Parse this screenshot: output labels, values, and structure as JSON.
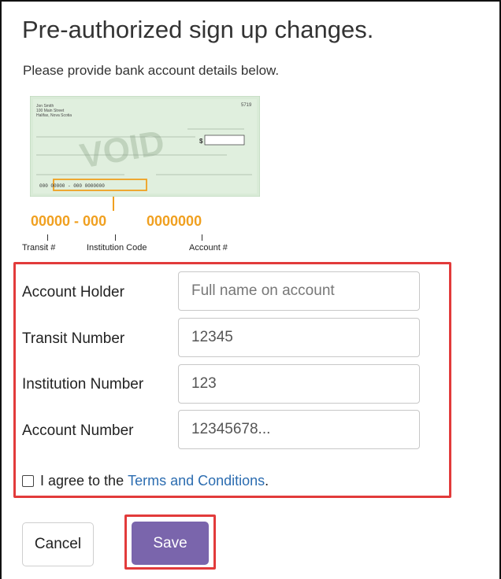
{
  "page": {
    "title": "Pre-authorized sign up changes.",
    "subtitle": "Please provide bank account details below."
  },
  "cheque": {
    "name_line1": "Jon Smith",
    "name_line2": "100 Main Street",
    "name_line3": "Halifax, Nova Scotia",
    "number": "5719",
    "void_text": "VOID",
    "micr": "000  00000 - 000  0000000",
    "digits_transit": "00000 - 000",
    "digits_account": "0000000",
    "label_transit": "Transit #",
    "label_institution": "Institution Code",
    "label_account": "Account #"
  },
  "form": {
    "account_holder": {
      "label": "Account Holder",
      "value": "",
      "placeholder": "Full name on account"
    },
    "transit_number": {
      "label": "Transit Number",
      "value": "12345"
    },
    "institution_number": {
      "label": "Institution Number",
      "value": "123"
    },
    "account_number": {
      "label": "Account Number",
      "value": "12345678..."
    },
    "agree_prefix": "I agree to the ",
    "agree_link": "Terms and Conditions",
    "agree_suffix": "."
  },
  "buttons": {
    "cancel": "Cancel",
    "save": "Save"
  },
  "colors": {
    "accent": "#7a65ac",
    "highlight": "#e23b3b",
    "digits": "#f0a020",
    "link": "#2b6cb0",
    "cheque_bg": "#d8ead6"
  }
}
